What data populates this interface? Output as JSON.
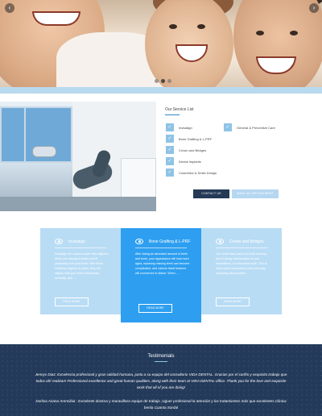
{
  "hero": {
    "prev_icon": "‹",
    "next_icon": "›",
    "slides": 3,
    "active_slide": 1
  },
  "services": {
    "title": "Our Service List",
    "check_icon": "✓",
    "items": [
      {
        "label": "Invisalign"
      },
      {
        "label": "General & Preventive Care"
      },
      {
        "label": "Bone Grafting & L-PRF"
      },
      {
        "label": "Crown and Bridges"
      },
      {
        "label": "Dental Implants"
      },
      {
        "label": "Cosmetics & Smile Design"
      }
    ],
    "contact_button": "CONTACT US",
    "appointment_button": "MAKE AN APPOINTMENT"
  },
  "cards": [
    {
      "title": "Invisalign",
      "text": "Invisalign are custom-made clear aligners, which are virtually invisible and fit pleasantly over your teeth. With these individual aligners in place, they will slightly shift your teeth horizontally, vertically, and ...",
      "button": "READ MORE"
    },
    {
      "title": "Bone Grafting & L-PRF",
      "text": "After losing an abundant amount of teeth and bone, your appearance will look more aged, replacing missing teeth can become complicated, and various facial features will commence to distort. When ...",
      "button": "READ MORE"
    },
    {
      "title": "Crown and Bridges",
      "text": "You could have parts of a tooth missing due to decay, deterioration of your restorations, or a fractured tooth. This is when tooth restorations come into play, replacing missing teeth ...",
      "button": "READ MORE"
    }
  ],
  "testimonials": {
    "title": "Testimonials",
    "quotes": [
      "Jennys Diaz: Excelencia profesional y gran calidad humana, junto a su equipo del consultorio VIDA DENTAL. Gracias por el cariño y exquisito trabajo que todos ahí realizan! Professional excellence and great human qualities, along with their team at VIDA DENTAL office. Thank you for the love and exquisite work that all of you are doing!",
      "Dorlisa Ariana Arencibia : Excelente doctora y maravilloso equipo de trabajo ,siguer profesional la atención y los tratamientos más que excelentes.Clinica berita Cuanta Sordal"
    ]
  }
}
